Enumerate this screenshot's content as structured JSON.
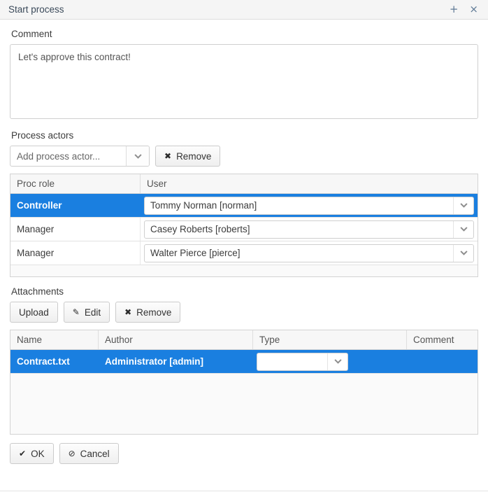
{
  "window": {
    "title": "Start process",
    "add_icon": "plus-icon",
    "close_icon": "close-icon",
    "add_glyph": "+",
    "close_glyph": "×"
  },
  "comment": {
    "label": "Comment",
    "value": "Let's approve this contract!",
    "placeholder": ""
  },
  "process_actors": {
    "label": "Process actors",
    "add_select": {
      "value": "Add process actor...",
      "options": [
        "Add process actor..."
      ]
    },
    "remove_button": "Remove",
    "columns": [
      "Proc role",
      "User"
    ],
    "rows": [
      {
        "role": "Controller",
        "user": "Tommy Norman [norman]",
        "selected": true
      },
      {
        "role": "Manager",
        "user": "Casey Roberts [roberts]",
        "selected": false
      },
      {
        "role": "Manager",
        "user": "Walter Pierce [pierce]",
        "selected": false
      }
    ]
  },
  "attachments": {
    "label": "Attachments",
    "upload_button": "Upload",
    "edit_button": "Edit",
    "remove_button": "Remove",
    "columns": [
      "Name",
      "Author",
      "Type",
      "Comment"
    ],
    "rows": [
      {
        "name": "Contract.txt",
        "author": "Administrator [admin]",
        "type": "",
        "comment": "",
        "selected": true
      }
    ]
  },
  "footer": {
    "ok_button": "OK",
    "cancel_button": "Cancel",
    "ok_icon_glyph": "✔",
    "cancel_icon_glyph": "⊘"
  },
  "colors": {
    "selection_blue": "#1a7fe0",
    "titlebar_bg": "#f5f5f5",
    "border": "#d3d3d3"
  }
}
